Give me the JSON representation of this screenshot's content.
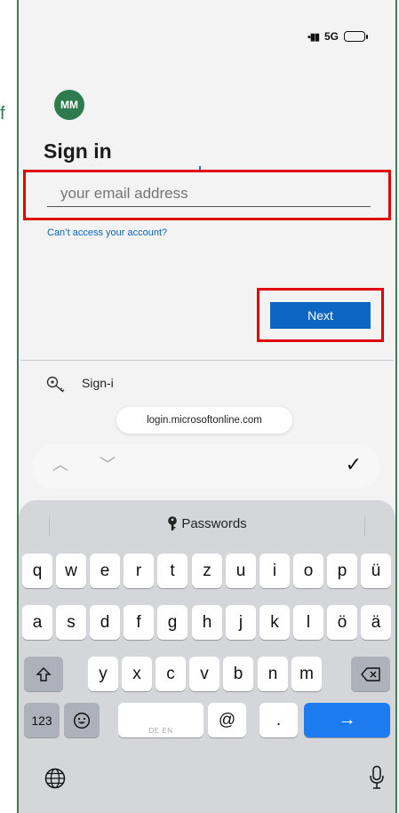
{
  "status": {
    "signal_icon": "signal-bars-icon",
    "network": "5G",
    "battery_icon": "battery-icon"
  },
  "margin_letter": "f",
  "page": {
    "avatar_initials": "MM",
    "title": "Sign in",
    "email_placeholder": "your email address",
    "cant_access_link": "Can’t access your account?",
    "next_label": "Next"
  },
  "sign_in_options": {
    "label": "Sign-i",
    "icon": "key-search-icon"
  },
  "url_pill": "login.microsoftonline.com",
  "accessory": {
    "done": "✓"
  },
  "keyboard": {
    "passwords_label": "Passwords",
    "row1": [
      "q",
      "w",
      "e",
      "r",
      "t",
      "z",
      "u",
      "i",
      "o",
      "p",
      "ü"
    ],
    "row2": [
      "a",
      "s",
      "d",
      "f",
      "g",
      "h",
      "j",
      "k",
      "l",
      "ö",
      "ä"
    ],
    "row3": [
      "y",
      "x",
      "c",
      "v",
      "b",
      "n",
      "m"
    ],
    "numbers_label": "123",
    "space_languages": "DE EN",
    "at_label": "@",
    "dot_label": ".",
    "go_symbol": "→"
  },
  "colors": {
    "accent": "#0d66c2",
    "avatar": "#2d7b4f",
    "highlight": "#e00000",
    "keyboard_bg": "#d5d6d9"
  }
}
